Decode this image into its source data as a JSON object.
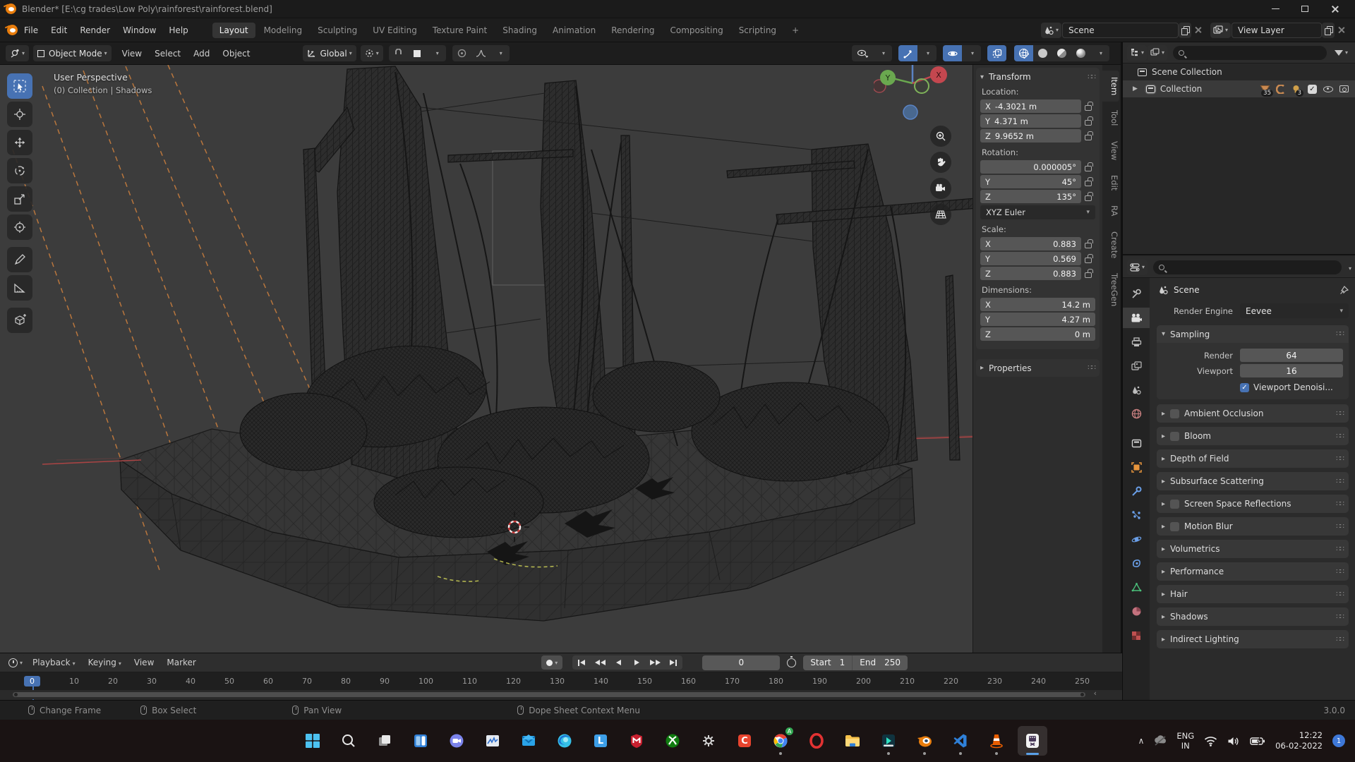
{
  "window": {
    "title": "Blender* [E:\\cg trades\\Low Poly\\rainforest\\rainforest.blend]"
  },
  "topbar": {
    "menus": [
      "File",
      "Edit",
      "Render",
      "Window",
      "Help"
    ],
    "workspaces": [
      "Layout",
      "Modeling",
      "Sculpting",
      "UV Editing",
      "Texture Paint",
      "Shading",
      "Animation",
      "Rendering",
      "Compositing",
      "Scripting"
    ],
    "new_workspace_label": "+",
    "scene_name": "Scene",
    "view_layer_name": "View Layer"
  },
  "viewport": {
    "mode": "Object Mode",
    "menus": [
      "View",
      "Select",
      "Add",
      "Object"
    ],
    "orientation": "Global",
    "overlay_line1": "User Perspective",
    "overlay_line2": "(0) Collection | Shadows",
    "axis": {
      "x": "X",
      "y": "Y",
      "z": "Z"
    }
  },
  "npanel": {
    "tabs": [
      "Item",
      "Tool",
      "View",
      "Edit",
      "RA",
      "Create",
      "TreeGen"
    ],
    "transform": {
      "title": "Transform",
      "location_label": "Location:",
      "loc": [
        {
          "axis": "X",
          "value": "-4.3021 m"
        },
        {
          "axis": "Y",
          "value": "4.371 m"
        },
        {
          "axis": "Z",
          "value": "9.9652 m"
        }
      ],
      "rotation_label": "Rotation:",
      "rot": [
        {
          "axis": "",
          "value": "0.000005°"
        },
        {
          "axis": "Y",
          "value": "45°"
        },
        {
          "axis": "Z",
          "value": "135°"
        }
      ],
      "euler_mode": "XYZ Euler",
      "scale_label": "Scale:",
      "scl": [
        {
          "axis": "X",
          "value": "0.883"
        },
        {
          "axis": "Y",
          "value": "0.569"
        },
        {
          "axis": "Z",
          "value": "0.883"
        }
      ],
      "dimensions_label": "Dimensions:",
      "dim": [
        {
          "axis": "X",
          "value": "14.2 m"
        },
        {
          "axis": "Y",
          "value": "4.27 m"
        },
        {
          "axis": "Z",
          "value": "0 m"
        }
      ],
      "properties_label": "Properties"
    }
  },
  "outliner": {
    "scene_collection": "Scene Collection",
    "collection": "Collection",
    "mesh_count": "35",
    "light_count": "3"
  },
  "properties": {
    "breadcrumb": "Scene",
    "render_engine_label": "Render Engine",
    "render_engine_value": "Eevee",
    "sampling": {
      "title": "Sampling",
      "render_label": "Render",
      "render_value": "64",
      "viewport_label": "Viewport",
      "viewport_value": "16",
      "denoise_label": "Viewport Denoisi..."
    },
    "panels": [
      {
        "label": "Ambient Occlusion"
      },
      {
        "label": "Bloom"
      },
      {
        "label": "Depth of Field"
      },
      {
        "label": "Subsurface Scattering"
      },
      {
        "label": "Screen Space Reflections"
      },
      {
        "label": "Motion Blur"
      },
      {
        "label": "Volumetrics"
      },
      {
        "label": "Performance"
      },
      {
        "label": "Hair"
      },
      {
        "label": "Shadows"
      },
      {
        "label": "Indirect Lighting"
      }
    ]
  },
  "timeline": {
    "menus": [
      "Playback",
      "Keying",
      "View",
      "Marker"
    ],
    "current_frame": "0",
    "start_label": "Start",
    "start_value": "1",
    "end_label": "End",
    "end_value": "250",
    "ticks": [
      "0",
      "10",
      "20",
      "30",
      "40",
      "50",
      "60",
      "70",
      "80",
      "90",
      "100",
      "110",
      "120",
      "130",
      "140",
      "150",
      "160",
      "170",
      "180",
      "190",
      "200",
      "210",
      "220",
      "230",
      "240",
      "250"
    ]
  },
  "statusbar": {
    "hints": [
      "Change Frame",
      "Box Select",
      "Pan View",
      "Dope Sheet Context Menu"
    ],
    "version": "3.0.0"
  },
  "taskbar": {
    "letters": {
      "docs": "L",
      "camtasia": "C",
      "chrome_badge": "A"
    },
    "tray": {
      "lang_line1": "ENG",
      "lang_line2": "IN",
      "clock_time": "12:22",
      "clock_date": "06-02-2022",
      "notif_count": "1"
    }
  }
}
